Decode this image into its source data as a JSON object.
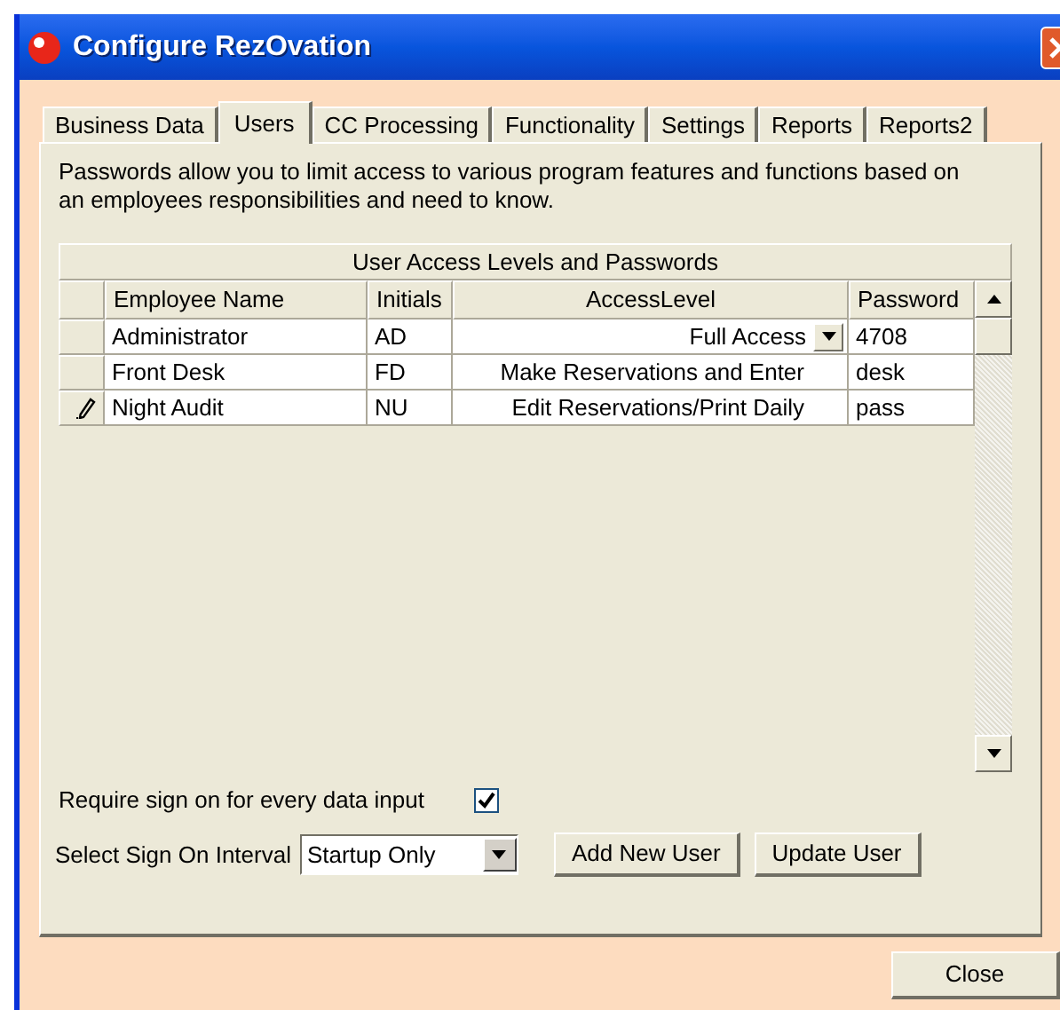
{
  "window": {
    "title": "Configure RezOvation"
  },
  "tabs": [
    {
      "label": "Business Data",
      "selected": false
    },
    {
      "label": "Users",
      "selected": true
    },
    {
      "label": "CC Processing",
      "selected": false
    },
    {
      "label": "Functionality",
      "selected": false
    },
    {
      "label": "Settings",
      "selected": false
    },
    {
      "label": "Reports",
      "selected": false
    },
    {
      "label": "Reports2",
      "selected": false
    }
  ],
  "description": "Passwords allow you to limit access to various program features and functions based on an employees responsibilities and need to know.",
  "table": {
    "caption": "User Access Levels and Passwords",
    "columns": [
      "Employee Name",
      "Initials",
      "AccessLevel",
      "Password"
    ],
    "rows": [
      {
        "cells": [
          "Administrator",
          "AD",
          "Full Access",
          "4708"
        ],
        "current_cell": true,
        "editing": false
      },
      {
        "cells": [
          "Front Desk",
          "FD",
          "Make Reservations and Enter",
          "desk"
        ],
        "current_cell": false,
        "editing": false
      },
      {
        "cells": [
          "Night Audit",
          "NU",
          "Edit Reservations/Print Daily",
          "pass"
        ],
        "current_cell": false,
        "editing": true
      }
    ]
  },
  "require_sign_on": {
    "label": "Require sign on for every data input",
    "checked": true
  },
  "sign_on_interval": {
    "label": "Select Sign On Interval",
    "value": "Startup Only"
  },
  "buttons": [
    "Add New User",
    "Update User"
  ],
  "close_button": "Close"
}
